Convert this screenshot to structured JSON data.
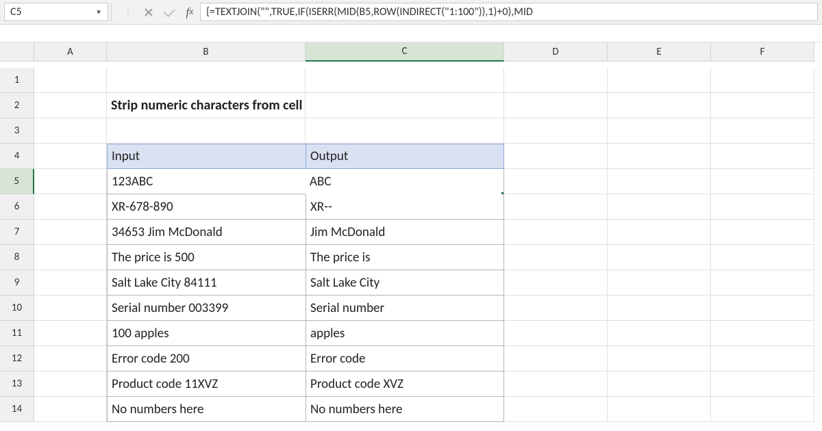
{
  "name_box": "C5",
  "formula": "{=TEXTJOIN(\"\",TRUE,IF(ISERR(MID(B5,ROW(INDIRECT(\"1:100\")),1)+0),MID",
  "columns": [
    "A",
    "B",
    "C",
    "D",
    "E",
    "F"
  ],
  "rows": [
    "1",
    "2",
    "3",
    "4",
    "5",
    "6",
    "7",
    "8",
    "9",
    "10",
    "11",
    "12",
    "13",
    "14"
  ],
  "title": "Strip numeric characters from cell",
  "table_headers": {
    "input": "Input",
    "output": "Output"
  },
  "table": [
    {
      "in": "123ABC",
      "out": "ABC"
    },
    {
      "in": "XR-678-890",
      "out": "XR--"
    },
    {
      "in": "34653 Jim McDonald",
      "out": " Jim McDonald"
    },
    {
      "in": "The price is 500",
      "out": "The price is "
    },
    {
      "in": "Salt Lake City 84111",
      "out": "Salt Lake City "
    },
    {
      "in": "Serial number 003399",
      "out": "Serial number "
    },
    {
      "in": "100 apples",
      "out": " apples"
    },
    {
      "in": "Error code 200",
      "out": "Error code "
    },
    {
      "in": "Product code 11XVZ",
      "out": "Product code XVZ"
    },
    {
      "in": "No numbers here",
      "out": "No numbers here"
    }
  ],
  "selected_cell": "C5",
  "selected_value": "ABC"
}
